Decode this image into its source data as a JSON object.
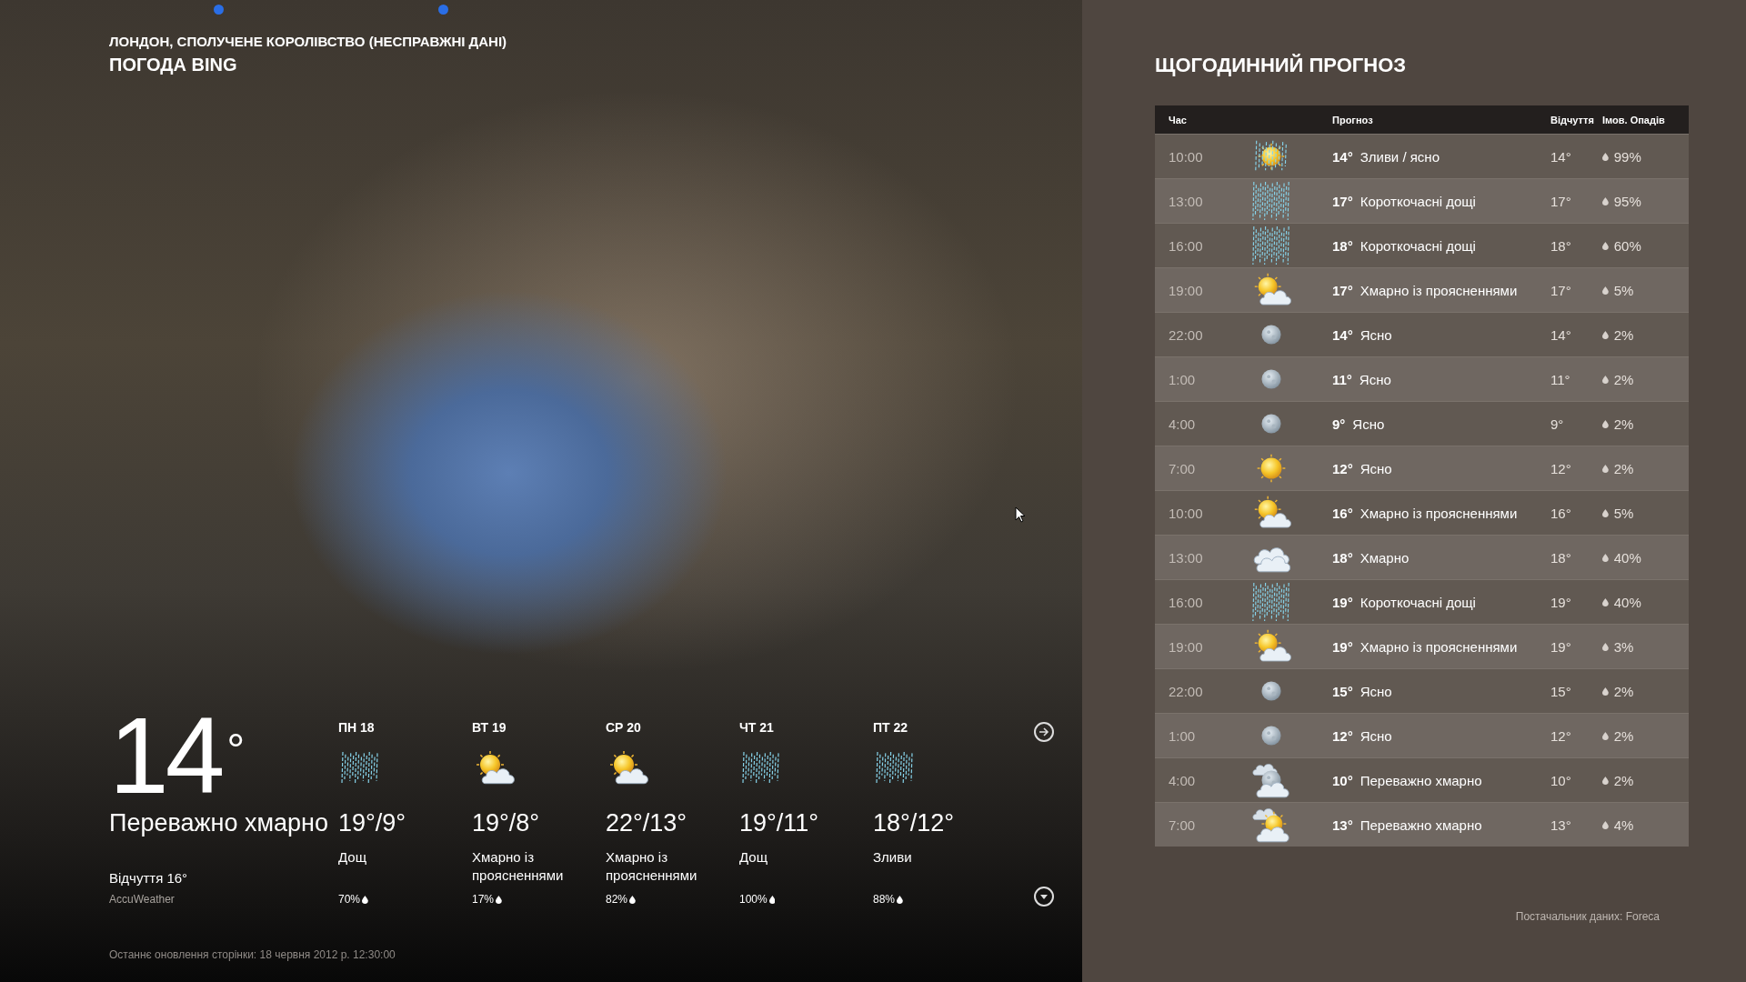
{
  "location": "ЛОНДОН, СПОЛУЧЕНЕ КОРОЛІВСТВО (НЕСПРАВЖНІ ДАНІ)",
  "app_title": "ПОГОДА BING",
  "current": {
    "temperature": "14$^{°}$",
    "condition": "Переважно хмарно",
    "feels_like": "Відчуття 16°",
    "provider": "AccuWeather"
  },
  "daily": [
    {
      "day": "ПН 18",
      "kind": "rain",
      "temps": "19°/9°",
      "condition": "Дощ",
      "precip": "70%"
    },
    {
      "day": "ВТ 19",
      "kind": "partly-cloudy",
      "temps": "19°/8°",
      "condition": "Хмарно із проясненнями",
      "precip": "17%"
    },
    {
      "day": "СР 20",
      "kind": "partly-cloudy",
      "temps": "22°/13°",
      "condition": "Хмарно із проясненнями",
      "precip": "82%"
    },
    {
      "day": "ЧТ 21",
      "kind": "rain",
      "temps": "19°/11°",
      "condition": "Дощ",
      "precip": "100%"
    },
    {
      "day": "ПТ 22",
      "kind": "rain",
      "temps": "18°/12°",
      "condition": "Зливи",
      "precip": "88%"
    }
  ],
  "last_updated": "Останнє оновлення сторінки: 18 червня 2012 р. 12:30:00",
  "hourly": {
    "title": "ЩОГОДИННИЙ ПРОГНОЗ",
    "header": {
      "time": "Час",
      "forecast": "Прогноз",
      "feels": "Відчуття",
      "precip": "Імов. Опадів"
    },
    "rows": [
      {
        "time": "10:00",
        "kind": "sun-showers",
        "temp": "14°",
        "forecast": "Зливи / ясно",
        "feels": "14°",
        "precip": "99%"
      },
      {
        "time": "13:00",
        "kind": "showers",
        "temp": "17°",
        "forecast": "Короткочасні дощі",
        "feels": "17°",
        "precip": "95%"
      },
      {
        "time": "16:00",
        "kind": "showers",
        "temp": "18°",
        "forecast": "Короткочасні дощі",
        "feels": "18°",
        "precip": "60%"
      },
      {
        "time": "19:00",
        "kind": "partly-cloudy",
        "temp": "17°",
        "forecast": "Хмарно із проясненнями",
        "feels": "17°",
        "precip": "5%"
      },
      {
        "time": "22:00",
        "kind": "moon",
        "temp": "14°",
        "forecast": "Ясно",
        "feels": "14°",
        "precip": "2%"
      },
      {
        "time": "1:00",
        "kind": "moon",
        "temp": "11°",
        "forecast": "Ясно",
        "feels": "11°",
        "precip": "2%"
      },
      {
        "time": "4:00",
        "kind": "moon",
        "temp": "9°",
        "forecast": "Ясно",
        "feels": "9°",
        "precip": "2%"
      },
      {
        "time": "7:00",
        "kind": "sun",
        "temp": "12°",
        "forecast": "Ясно",
        "feels": "12°",
        "precip": "2%"
      },
      {
        "time": "10:00",
        "kind": "partly-cloudy",
        "temp": "16°",
        "forecast": "Хмарно із проясненнями",
        "feels": "16°",
        "precip": "5%"
      },
      {
        "time": "13:00",
        "kind": "cloudy",
        "temp": "18°",
        "forecast": "Хмарно",
        "feels": "18°",
        "precip": "40%"
      },
      {
        "time": "16:00",
        "kind": "showers",
        "temp": "19°",
        "forecast": "Короткочасні дощі",
        "feels": "19°",
        "precip": "40%"
      },
      {
        "time": "19:00",
        "kind": "partly-cloudy",
        "temp": "19°",
        "forecast": "Хмарно із проясненнями",
        "feels": "19°",
        "precip": "3%"
      },
      {
        "time": "22:00",
        "kind": "moon",
        "temp": "15°",
        "forecast": "Ясно",
        "feels": "15°",
        "precip": "2%"
      },
      {
        "time": "1:00",
        "kind": "moon",
        "temp": "12°",
        "forecast": "Ясно",
        "feels": "12°",
        "precip": "2%"
      },
      {
        "time": "4:00",
        "kind": "mostly-cloudy-night",
        "temp": "10°",
        "forecast": "Переважно хмарно",
        "feels": "10°",
        "precip": "2%"
      },
      {
        "time": "7:00",
        "kind": "mostly-cloudy-day",
        "temp": "13°",
        "forecast": "Переважно хмарно",
        "feels": "13°",
        "precip": "4%"
      }
    ]
  },
  "data_provider": "Постачальник даних: Foreca"
}
